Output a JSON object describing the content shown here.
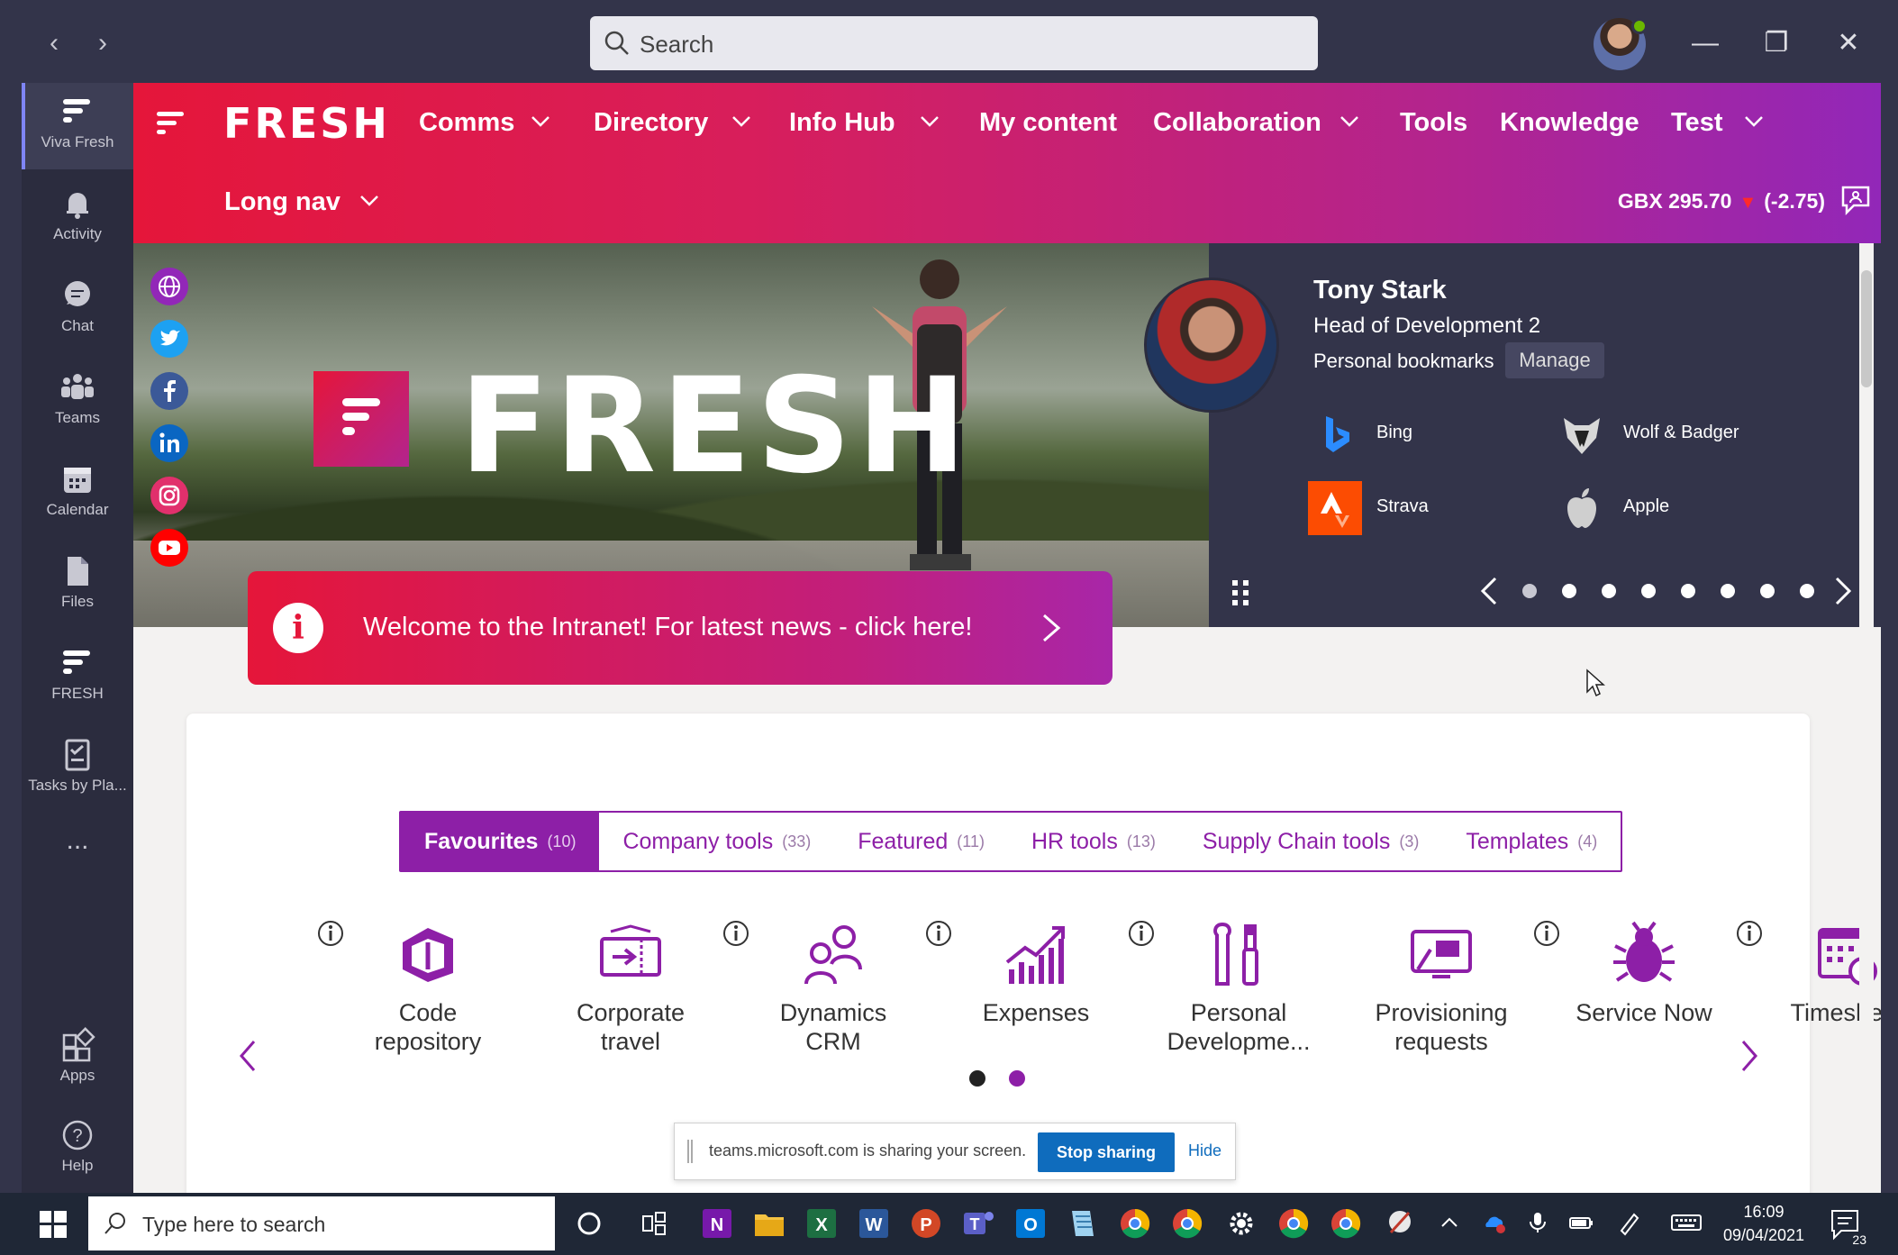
{
  "window": {
    "search_placeholder": "Search"
  },
  "rail": {
    "items": [
      {
        "label": "Viva Fresh",
        "icon": "fresh-icon"
      },
      {
        "label": "Activity",
        "icon": "bell-icon"
      },
      {
        "label": "Chat",
        "icon": "chat-icon"
      },
      {
        "label": "Teams",
        "icon": "teams-icon"
      },
      {
        "label": "Calendar",
        "icon": "calendar-icon"
      },
      {
        "label": "Files",
        "icon": "file-icon"
      },
      {
        "label": "FRESH",
        "icon": "fresh-icon"
      },
      {
        "label": "Tasks by Pla...",
        "icon": "tasks-icon"
      },
      {
        "label": "...",
        "icon": "more-icon"
      },
      {
        "label": "Apps",
        "icon": "apps-icon"
      },
      {
        "label": "Help",
        "icon": "help-icon"
      }
    ]
  },
  "topnav": {
    "brand": "FRESH",
    "items": [
      {
        "label": "Comms",
        "has_dropdown": true
      },
      {
        "label": "Directory",
        "has_dropdown": true
      },
      {
        "label": "Info Hub",
        "has_dropdown": true
      },
      {
        "label": "My content",
        "has_dropdown": false
      },
      {
        "label": "Collaboration",
        "has_dropdown": true
      },
      {
        "label": "Tools",
        "has_dropdown": false
      },
      {
        "label": "Knowledge",
        "has_dropdown": false
      },
      {
        "label": "Test",
        "has_dropdown": true
      }
    ],
    "second_row": {
      "label": "Long nav",
      "has_dropdown": true
    },
    "stock": {
      "ticker": "GBX 295.70",
      "change": "(-2.75)",
      "direction": "down"
    }
  },
  "hero": {
    "title": "FRESH",
    "social": [
      "globe-icon",
      "twitter-icon",
      "facebook-icon",
      "linkedin-icon",
      "instagram-icon",
      "youtube-icon"
    ],
    "banner": {
      "icon": "i",
      "text": "Welcome to the Intranet! For latest news - click here!"
    }
  },
  "profile": {
    "name": "Tony Stark",
    "role": "Head of Development 2",
    "bookmarks_label": "Personal bookmarks",
    "manage_label": "Manage",
    "bookmarks": [
      {
        "label": "Bing",
        "icon": "bing-icon"
      },
      {
        "label": "Wolf & Badger",
        "icon": "wolf-badger-icon"
      },
      {
        "label": "Strava",
        "icon": "strava-icon"
      },
      {
        "label": "Apple",
        "icon": "apple-icon"
      }
    ],
    "carousel": {
      "pages": 8,
      "active": 1
    }
  },
  "tools": {
    "tabs": [
      {
        "label": "Favourites",
        "count": "(10)",
        "active": true
      },
      {
        "label": "Company tools",
        "count": "(33)",
        "active": false
      },
      {
        "label": "Featured",
        "count": "(11)",
        "active": false
      },
      {
        "label": "HR tools",
        "count": "(13)",
        "active": false
      },
      {
        "label": "Supply Chain tools",
        "count": "(3)",
        "active": false
      },
      {
        "label": "Templates",
        "count": "(4)",
        "active": false
      }
    ],
    "items": [
      {
        "label": "Code repository",
        "icon": "code-repository-icon",
        "info": true
      },
      {
        "label": "Corporate travel",
        "icon": "plane-ticket-icon",
        "info": false
      },
      {
        "label": "Dynamics CRM",
        "icon": "people-icon",
        "info": true
      },
      {
        "label": "Expenses",
        "icon": "chart-growth-icon",
        "info": true
      },
      {
        "label": "Personal Developme...",
        "icon": "tools-icon",
        "info": true
      },
      {
        "label": "Provisioning requests",
        "icon": "devices-icon",
        "info": false
      },
      {
        "label": "Service Now",
        "icon": "bug-icon",
        "info": true
      },
      {
        "label": "Timesheet",
        "icon": "calendar-clock-icon",
        "info": true
      }
    ],
    "pages": 2,
    "active_page": 2
  },
  "share_bar": {
    "text": "teams.microsoft.com is sharing your screen.",
    "stop_label": "Stop sharing",
    "hide_label": "Hide"
  },
  "taskbar": {
    "search_placeholder": "Type here to search",
    "time": "16:09",
    "date": "09/04/2021",
    "notifications": "23"
  },
  "colors": {
    "accent": "#8d1fa7",
    "nav_gradient_start": "#e5163a",
    "nav_gradient_end": "#9227b8",
    "teams_dark": "#33344a"
  }
}
